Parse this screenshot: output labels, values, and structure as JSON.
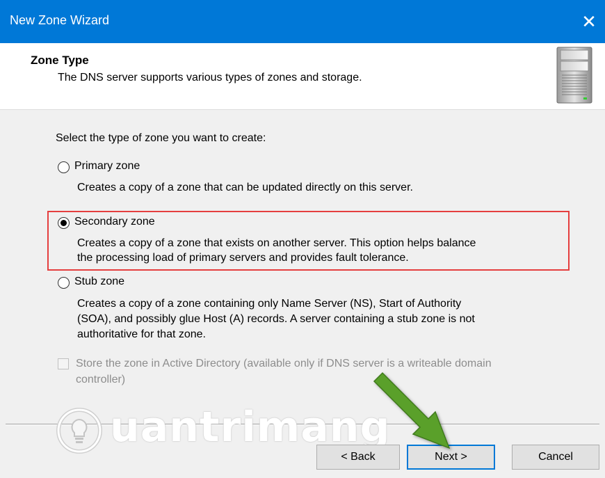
{
  "window": {
    "title": "New Zone Wizard",
    "close_glyph": "✕"
  },
  "header": {
    "title": "Zone Type",
    "subtitle": "The DNS server supports various types of zones and storage."
  },
  "prompt": "Select the type of zone you want to create:",
  "options": [
    {
      "label": "Primary zone",
      "selected": false,
      "description": [
        "Creates a copy of a zone that can be updated directly on this server."
      ]
    },
    {
      "label": "Secondary zone",
      "selected": true,
      "description": [
        "Creates a copy of a zone that exists on another server. This option helps balance",
        "the processing load of primary servers and provides fault tolerance."
      ]
    },
    {
      "label": "Stub zone",
      "selected": false,
      "description": [
        "Creates a copy of a zone containing only Name Server (NS), Start of Authority",
        "(SOA), and possibly glue Host (A) records. A server containing a stub zone is not",
        "authoritative for that zone."
      ]
    }
  ],
  "store_ad": {
    "checked": false,
    "enabled": false,
    "label_lines": [
      "Store the zone in Active Directory (available only if DNS server is a writeable domain",
      "controller)"
    ]
  },
  "buttons": {
    "back": "< Back",
    "next": "Next >",
    "cancel": "Cancel"
  },
  "watermark": "uantrimang",
  "colors": {
    "titlebar": "#0078d7",
    "highlight": "#e53e3e",
    "arrow": "#5aa02c"
  },
  "icons": {
    "server": "server-tower-icon",
    "close": "close-icon",
    "watermark_logo": "lightbulb-icon",
    "arrow": "arrow-pointer-icon"
  }
}
